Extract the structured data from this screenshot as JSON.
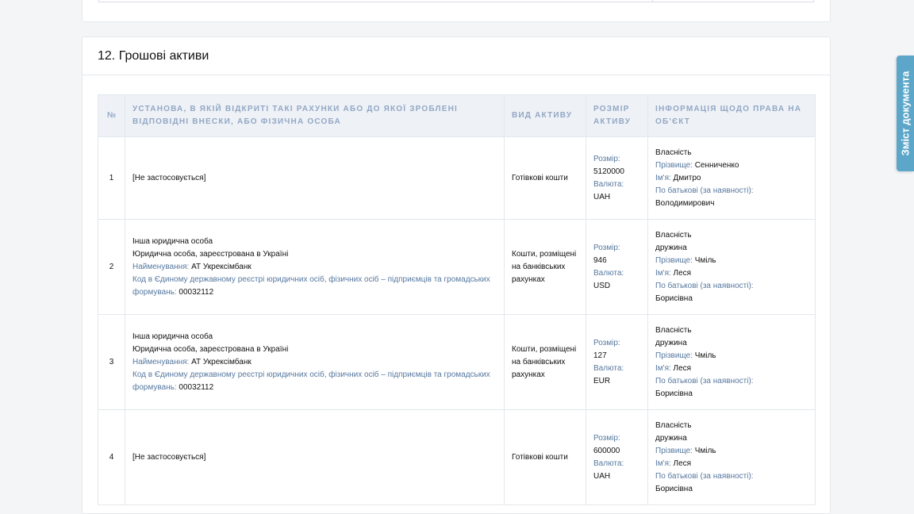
{
  "section": {
    "title": "12. Грошові активи"
  },
  "side_tab": {
    "label": "Зміст документа"
  },
  "table": {
    "headers": {
      "num": "№",
      "institution": "Установа, в якій відкриті такі рахунки або до якої зроблені відповідні внески, або фізична особа",
      "asset_type": "Вид активу",
      "amount": "Розмір активу",
      "rights": "Інформація щодо права на об'єкт"
    },
    "rows": [
      {
        "num": "1",
        "institution": {
          "text": "[Не застосовується]"
        },
        "asset_type": "Готівкові кошти",
        "amount": {
          "size_label": "Розмір:",
          "size": "5120000",
          "currency_label": "Валюта:",
          "currency": "UAH"
        },
        "rights": {
          "ownership": "Власність",
          "surname_label": "Прізвище:",
          "surname": "Сенниченко",
          "name_label": "Ім'я:",
          "name": "Дмитро",
          "patronymic_label": "По батькові (за наявності):",
          "patronymic": "Володимирович"
        }
      },
      {
        "num": "2",
        "institution": {
          "type": "Інша юридична особа",
          "registration": "Юридична особа, зареєстрована в Україні",
          "name_label": "Найменування:",
          "name": "АТ Укрексімбанк",
          "code_label": "Код в Єдиному державному реєстрі юридичних осіб, фізичних осіб – підприємців та громадських формувань:",
          "code": "00032112"
        },
        "asset_type": "Кошти, розміщені на банківських рахунках",
        "amount": {
          "size_label": "Розмір:",
          "size": "946",
          "currency_label": "Валюта:",
          "currency": "USD"
        },
        "rights": {
          "ownership": "Власність",
          "relation": "дружина",
          "surname_label": "Прізвище:",
          "surname": "Чміль",
          "name_label": "Ім'я:",
          "name": "Леся",
          "patronymic_label": "По батькові (за наявності):",
          "patronymic": "Борисівна"
        }
      },
      {
        "num": "3",
        "institution": {
          "type": "Інша юридична особа",
          "registration": "Юридична особа, зареєстрована в Україні",
          "name_label": "Найменування:",
          "name": "АТ Укрексімбанк",
          "code_label": "Код в Єдиному державному реєстрі юридичних осіб, фізичних осіб – підприємців та громадських формувань:",
          "code": "00032112"
        },
        "asset_type": "Кошти, розміщені на банківських рахунках",
        "amount": {
          "size_label": "Розмір:",
          "size": "127",
          "currency_label": "Валюта:",
          "currency": "EUR"
        },
        "rights": {
          "ownership": "Власність",
          "relation": "дружина",
          "surname_label": "Прізвище:",
          "surname": "Чміль",
          "name_label": "Ім'я:",
          "name": "Леся",
          "patronymic_label": "По батькові (за наявності):",
          "patronymic": "Борисівна"
        }
      },
      {
        "num": "4",
        "institution": {
          "text": "[Не застосовується]"
        },
        "asset_type": "Готівкові кошти",
        "amount": {
          "size_label": "Розмір:",
          "size": "600000",
          "currency_label": "Валюта:",
          "currency": "UAH"
        },
        "rights": {
          "ownership": "Власність",
          "relation": "дружина",
          "surname_label": "Прізвище:",
          "surname": "Чміль",
          "name_label": "Ім'я:",
          "name": "Леся",
          "patronymic_label": "По батькові (за наявності):",
          "patronymic": "Борисівна"
        }
      }
    ]
  },
  "colors": {
    "label_blue": "#56789f",
    "header_text": "#93a7c4",
    "header_bg": "#eef2f7",
    "side_tab_bg": "#5ca7c9"
  }
}
